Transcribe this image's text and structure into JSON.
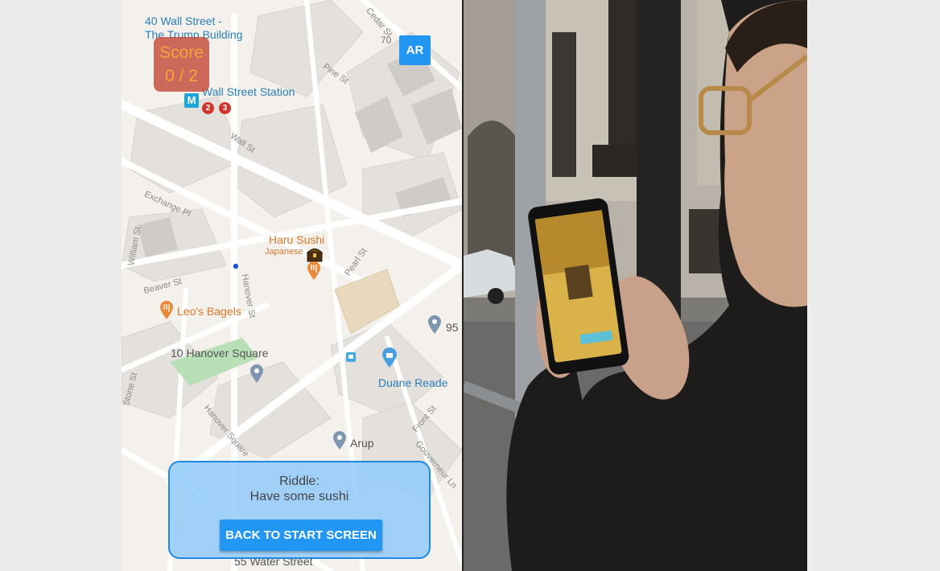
{
  "map": {
    "score": {
      "label": "Score",
      "value": "0 / 2"
    },
    "ar_button": "AR",
    "riddle": {
      "title": "Riddle:",
      "text": "Have some sushi",
      "button": "BACK TO START SCREEN"
    },
    "places": {
      "wall40_line1": "40 Wall Street -",
      "wall40_line2": "The Trump Building",
      "wall_station": "Wall Street Station",
      "line2": "2",
      "line3": "3",
      "metro": "M",
      "haru": "Haru Sushi",
      "haru_sub": "Japanese",
      "leos": "Leo's Bagels",
      "hanover_sq10": "10 Hanover Square",
      "duane": "Duane Reade",
      "arup": "Arup",
      "num95": "95",
      "water55": "55 Water Street",
      "num70": "70"
    },
    "streets": {
      "pine": "Pine St",
      "wall": "Wall St",
      "cedar": "Cedar St",
      "exchange": "Exchange Pl",
      "william": "William St",
      "beaver": "Beaver St",
      "hanover": "Hanover St",
      "pearl": "Pearl St",
      "stone": "Stone St",
      "hanover_square": "Hanover Square",
      "front": "Front St",
      "gouverneur": "Gouverneur Ln"
    }
  },
  "photo": {}
}
